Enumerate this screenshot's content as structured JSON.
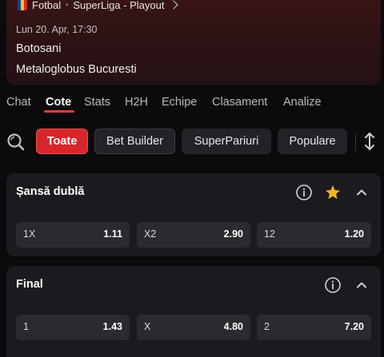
{
  "match": {
    "sport": "Fotbal",
    "separator": "•",
    "league": "SuperLiga - Playout",
    "flag_colors": [
      "#1f3c9c",
      "#f2c416",
      "#d22a2f"
    ],
    "datetime": "Lun 20. Apr, 17:30",
    "home_team": "Botosani",
    "away_team": "Metaloglobus Bucuresti"
  },
  "tabs": [
    {
      "label": "Chat",
      "active": false
    },
    {
      "label": "Cote",
      "active": true
    },
    {
      "label": "Stats",
      "active": false
    },
    {
      "label": "H2H",
      "active": false
    },
    {
      "label": "Echipe",
      "active": false
    },
    {
      "label": "Clasament",
      "active": false
    },
    {
      "label": "Analize",
      "active": false
    }
  ],
  "filters": {
    "search_icon": "search-icon",
    "chips": [
      {
        "label": "Toate",
        "active": true
      },
      {
        "label": "Bet Builder",
        "active": false
      },
      {
        "label": "SuperPariuri",
        "active": false
      },
      {
        "label": "Populare",
        "active": false
      }
    ],
    "sort_icon": "sort-vertical-icon"
  },
  "markets": [
    {
      "title": "Șansă dublă",
      "icons": [
        "info-icon",
        "star-icon",
        "chevron-up-icon"
      ],
      "favorite": true,
      "outcomes": [
        {
          "label": "1X",
          "odds": "1.11"
        },
        {
          "label": "X2",
          "odds": "2.90"
        },
        {
          "label": "12",
          "odds": "1.20"
        }
      ]
    },
    {
      "title": "Final",
      "icons": [
        "info-icon",
        "chevron-up-icon"
      ],
      "favorite": false,
      "outcomes": [
        {
          "label": "1",
          "odds": "1.43"
        },
        {
          "label": "X",
          "odds": "4.80"
        },
        {
          "label": "2",
          "odds": "7.20"
        }
      ]
    }
  ],
  "colors": {
    "accent": "#d6262b",
    "star": "#f0b51f",
    "background": "#0b0b0d",
    "card": "#1b1b1f",
    "odds_cell": "#2a2a2f"
  }
}
